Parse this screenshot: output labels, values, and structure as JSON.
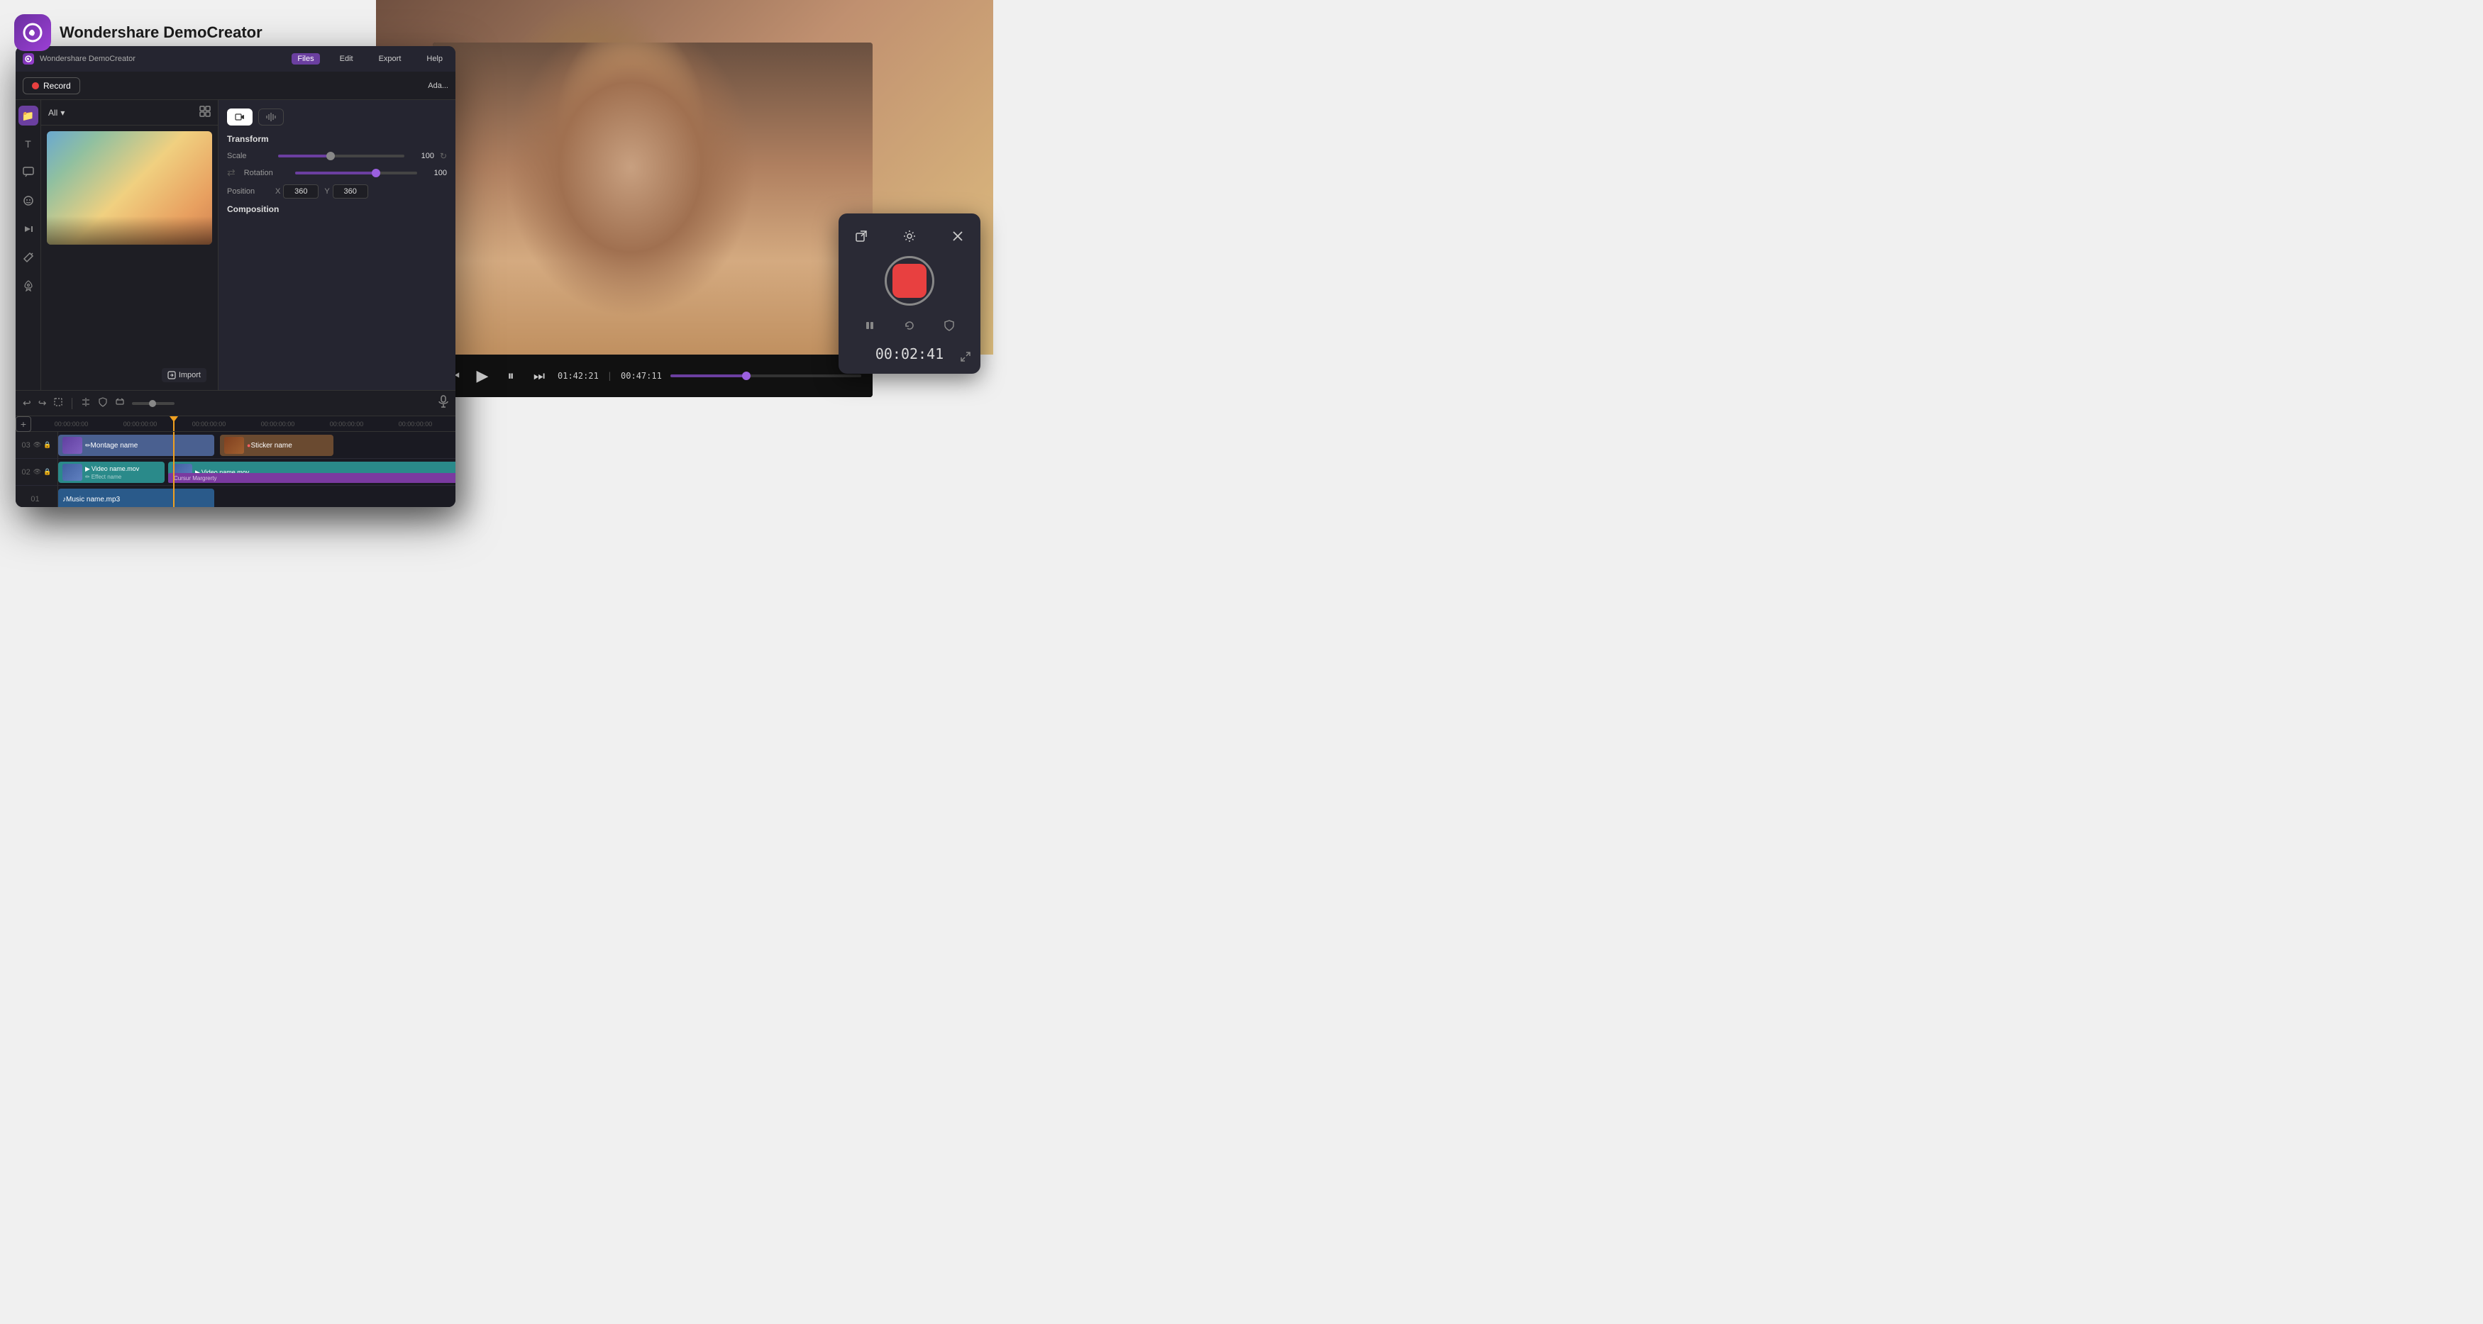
{
  "app": {
    "name": "Wondershare DemoCreator",
    "logo_char": "©"
  },
  "titlebar": {
    "app_name": "Wondershare DemoCreator",
    "menus": [
      "Files",
      "Edit",
      "Export",
      "Help"
    ],
    "active_menu": "Files"
  },
  "toolbar": {
    "record_label": "Record",
    "adapt_label": "Ada..."
  },
  "sidebar": {
    "icons": [
      "📁",
      "T",
      "💬",
      "😊",
      "⏭",
      "✂️",
      "🚀"
    ]
  },
  "files_panel": {
    "dropdown_label": "All",
    "import_label": "Import"
  },
  "transform": {
    "section_label": "Transform",
    "scale_label": "Scale",
    "scale_value": "100",
    "scale_percent": 40,
    "rotation_label": "Rotation",
    "rotation_value": "100",
    "rotation_percent": 65,
    "position_label": "Position",
    "pos_x_label": "X",
    "pos_x_value": "360",
    "pos_y_label": "Y",
    "pos_y_value": "360"
  },
  "composition": {
    "section_label": "Composition"
  },
  "prop_tabs": {
    "video_tab": "video",
    "audio_tab": "audio"
  },
  "video_controls": {
    "time_current": "01:42:21",
    "time_total": "00:47:11",
    "separator": "|"
  },
  "timeline": {
    "ruler_marks": [
      "00:00:00:00",
      "00:00:00:00",
      "00:00:00:00",
      "00:00:00:00",
      "00:00:00:00",
      "00:00:00:00"
    ],
    "tracks": {
      "track3_num": "03",
      "track2_num": "02",
      "track1_num": "01"
    },
    "clips": {
      "montage_name": "Montage name",
      "sticker_name": "Sticker name",
      "video1_name": "Video name.mov",
      "video2_name": "Video name.mov",
      "effect_name": "Effect name",
      "cursor_name": "Cursur Margrerty",
      "music_name": "Music name.mp3"
    }
  },
  "recording_popup": {
    "timer": "00:02:41"
  },
  "icons": {
    "record_dot": "●",
    "play": "▶",
    "pause": "⏸",
    "prev": "⏮",
    "next": "⏭",
    "undo": "↩",
    "redo": "↪",
    "crop": "⊡",
    "split": "⊞",
    "shield": "⛨",
    "expand_frame": "⊞",
    "mic": "🎙",
    "add": "+",
    "eye": "👁",
    "lock": "🔒",
    "pencil": "✏",
    "external_link": "⧉",
    "settings": "⚙",
    "close": "✕",
    "fullscreen": "⤢",
    "pause_rec": "⏸",
    "refresh_rec": "↺",
    "shield_rec": "⛨",
    "chevron_down": "▾",
    "grid": "⊞",
    "import": "⊕"
  }
}
